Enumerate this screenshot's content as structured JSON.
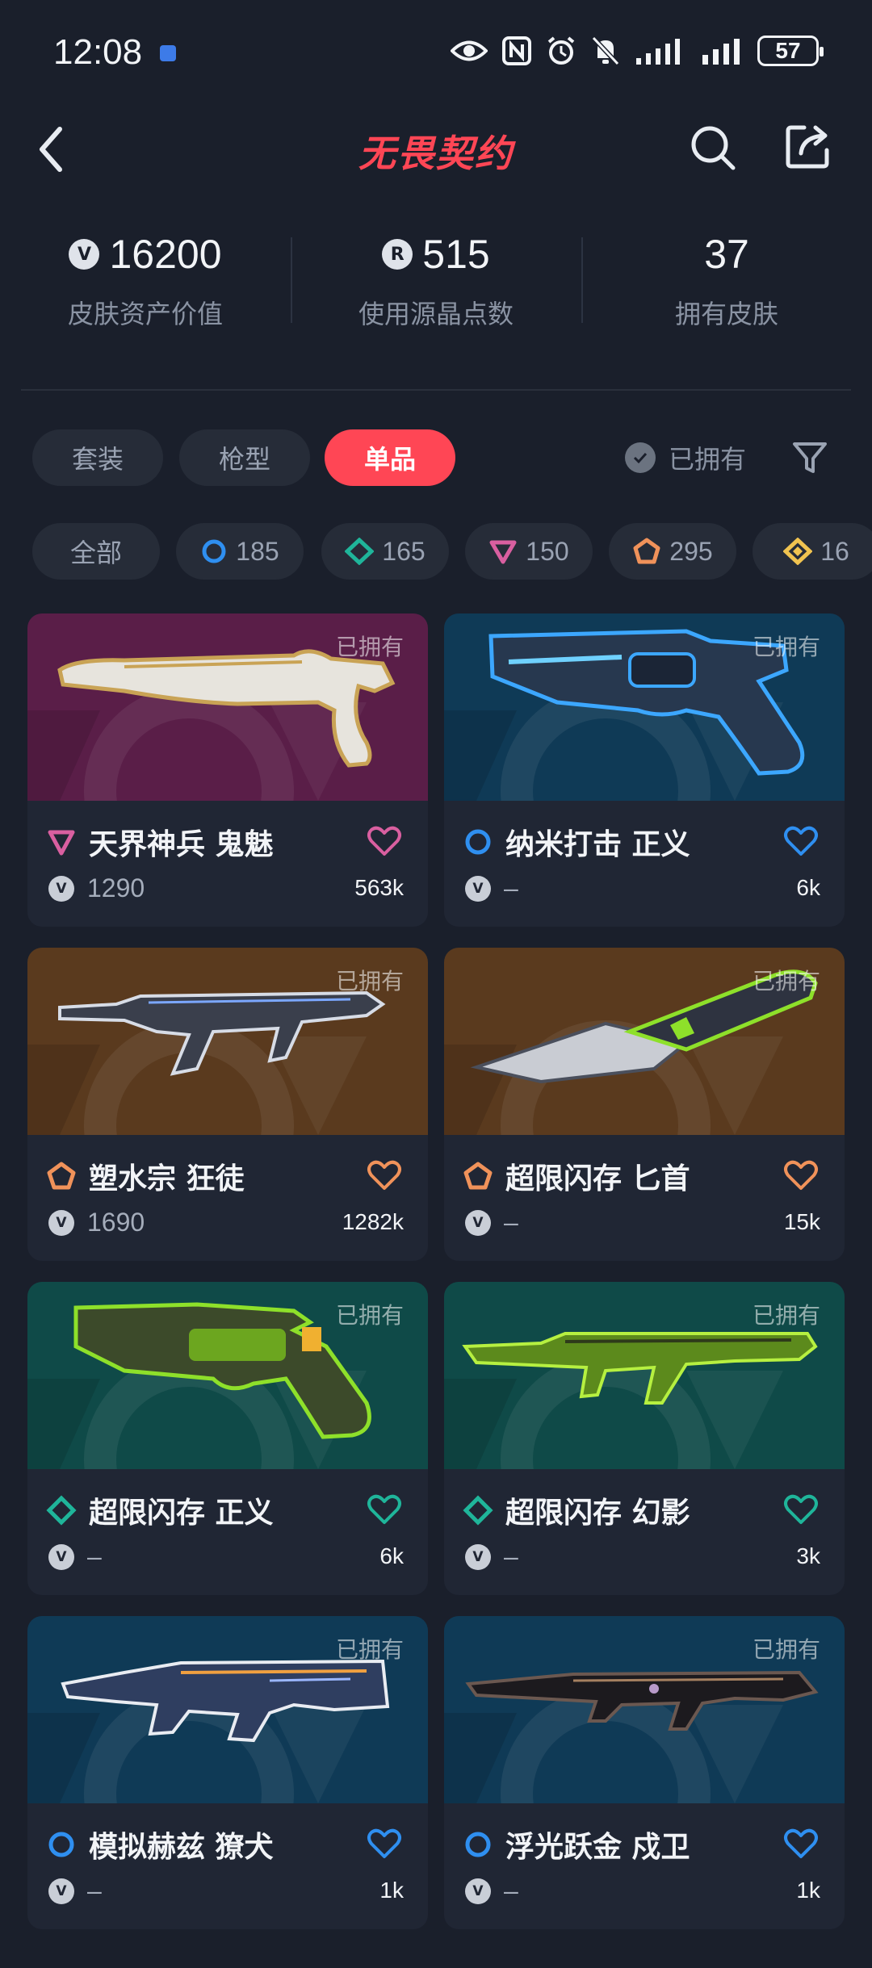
{
  "status_bar": {
    "time": "12:08",
    "battery": "57"
  },
  "header": {
    "title": "无畏契约",
    "back_icon": "chevron-left-icon",
    "search_icon": "search-icon",
    "share_icon": "share-icon"
  },
  "stats": [
    {
      "icon": "vp-currency-icon",
      "icon_text": "V",
      "value": "16200",
      "label": "皮肤资产价值"
    },
    {
      "icon": "radianite-icon",
      "icon_text": "R",
      "value": "515",
      "label": "使用源晶点数"
    },
    {
      "icon": "",
      "icon_text": "",
      "value": "37",
      "label": "拥有皮肤"
    }
  ],
  "tabs": [
    {
      "label": "套装",
      "active": false
    },
    {
      "label": "枪型",
      "active": false
    },
    {
      "label": "单品",
      "active": true
    }
  ],
  "owned_toggle": {
    "label": "已拥有"
  },
  "chips": [
    {
      "label": "全部",
      "icon": "",
      "color": ""
    },
    {
      "label": "185",
      "icon": "select-tier-icon",
      "color": "#2f8ff0"
    },
    {
      "label": "165",
      "icon": "deluxe-tier-icon",
      "color": "#1fb59a"
    },
    {
      "label": "150",
      "icon": "premium-tier-icon",
      "color": "#d95fa0"
    },
    {
      "label": "295",
      "icon": "exclusive-tier-icon",
      "color": "#f0925a"
    },
    {
      "label": "16",
      "icon": "ultra-tier-icon",
      "color": "#f0c350"
    }
  ],
  "cards": [
    {
      "name": "天界神兵 鬼魅",
      "owned": "已拥有",
      "price": "1290",
      "likes": "563k",
      "tier": "premium-tier-icon",
      "tier_color": "#d95fa0",
      "bg": "#5a1e48",
      "weapon": "ghost-pistol"
    },
    {
      "name": "纳米打击 正义",
      "owned": "已拥有",
      "price": "–",
      "likes": "6k",
      "tier": "select-tier-icon",
      "tier_color": "#2f8ff0",
      "bg": "#0f3a56",
      "weapon": "sheriff-revolver"
    },
    {
      "name": "塑水宗 狂徒",
      "owned": "已拥有",
      "price": "1690",
      "likes": "1282k",
      "tier": "exclusive-tier-icon",
      "tier_color": "#f0925a",
      "bg": "#5a3a1e",
      "weapon": "vandal-rifle"
    },
    {
      "name": "超限闪存 匕首",
      "owned": "已拥有",
      "price": "–",
      "likes": "15k",
      "tier": "exclusive-tier-icon",
      "tier_color": "#f0925a",
      "bg": "#5a3a1e",
      "weapon": "knife"
    },
    {
      "name": "超限闪存 正义",
      "owned": "已拥有",
      "price": "–",
      "likes": "6k",
      "tier": "deluxe-tier-icon",
      "tier_color": "#1fb59a",
      "bg": "#0f4a48",
      "weapon": "green-revolver"
    },
    {
      "name": "超限闪存 幻影",
      "owned": "已拥有",
      "price": "–",
      "likes": "3k",
      "tier": "deluxe-tier-icon",
      "tier_color": "#1fb59a",
      "bg": "#0f4a48",
      "weapon": "green-rifle"
    },
    {
      "name": "模拟赫兹 獠犬",
      "owned": "已拥有",
      "price": "–",
      "likes": "1k",
      "tier": "select-tier-icon",
      "tier_color": "#2f8ff0",
      "bg": "#0f3a56",
      "weapon": "bulldog-rifle"
    },
    {
      "name": "浮光跃金 戍卫",
      "owned": "已拥有",
      "price": "–",
      "likes": "1k",
      "tier": "select-tier-icon",
      "tier_color": "#2f8ff0",
      "bg": "#0f3a56",
      "weapon": "guardian-rifle"
    }
  ]
}
